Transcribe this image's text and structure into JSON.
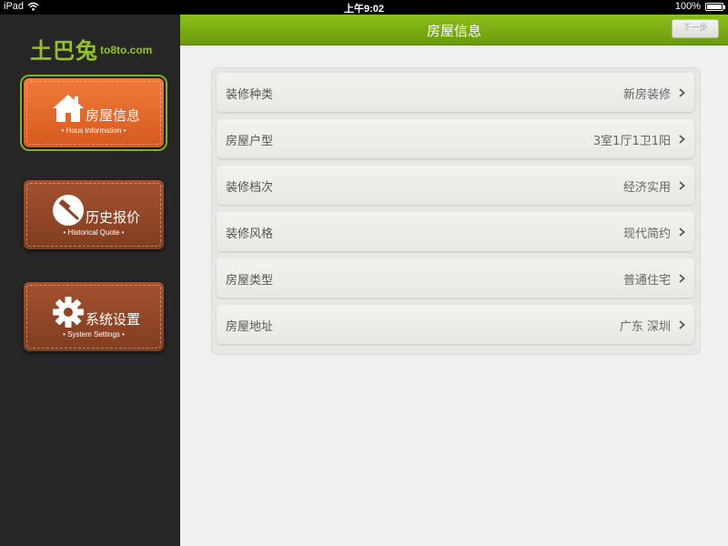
{
  "status_bar": {
    "device": "iPad",
    "time": "上午9:02",
    "battery": "100%",
    "battery_level": 1.0
  },
  "sidebar": {
    "logo_cn": "土巴兔",
    "logo_en": "to8to.com",
    "items": [
      {
        "label": "房屋信息",
        "sub": "• Hous Information •",
        "icon": "house-icon",
        "active": true
      },
      {
        "label": "历史报价",
        "sub": "• Historical Quote •",
        "icon": "gavel-icon",
        "active": false
      },
      {
        "label": "系统设置",
        "sub": "• System Settings •",
        "icon": "gear-icon",
        "active": false
      }
    ]
  },
  "header": {
    "title": "房屋信息",
    "next_label": "下一步"
  },
  "form": {
    "rows": [
      {
        "key": "装修种类",
        "value": "新房装修"
      },
      {
        "key": "房屋户型",
        "value": "3室1厅1卫1阳"
      },
      {
        "key": "装修档次",
        "value": "经济实用"
      },
      {
        "key": "装修风格",
        "value": "现代简约"
      },
      {
        "key": "房屋类型",
        "value": "普通住宅"
      },
      {
        "key": "房屋地址",
        "value": "广东 深圳"
      }
    ]
  },
  "colors": {
    "accent_green": "#7fb21e",
    "active_orange": "#e66a2a",
    "inactive_brown": "#8f4524"
  }
}
